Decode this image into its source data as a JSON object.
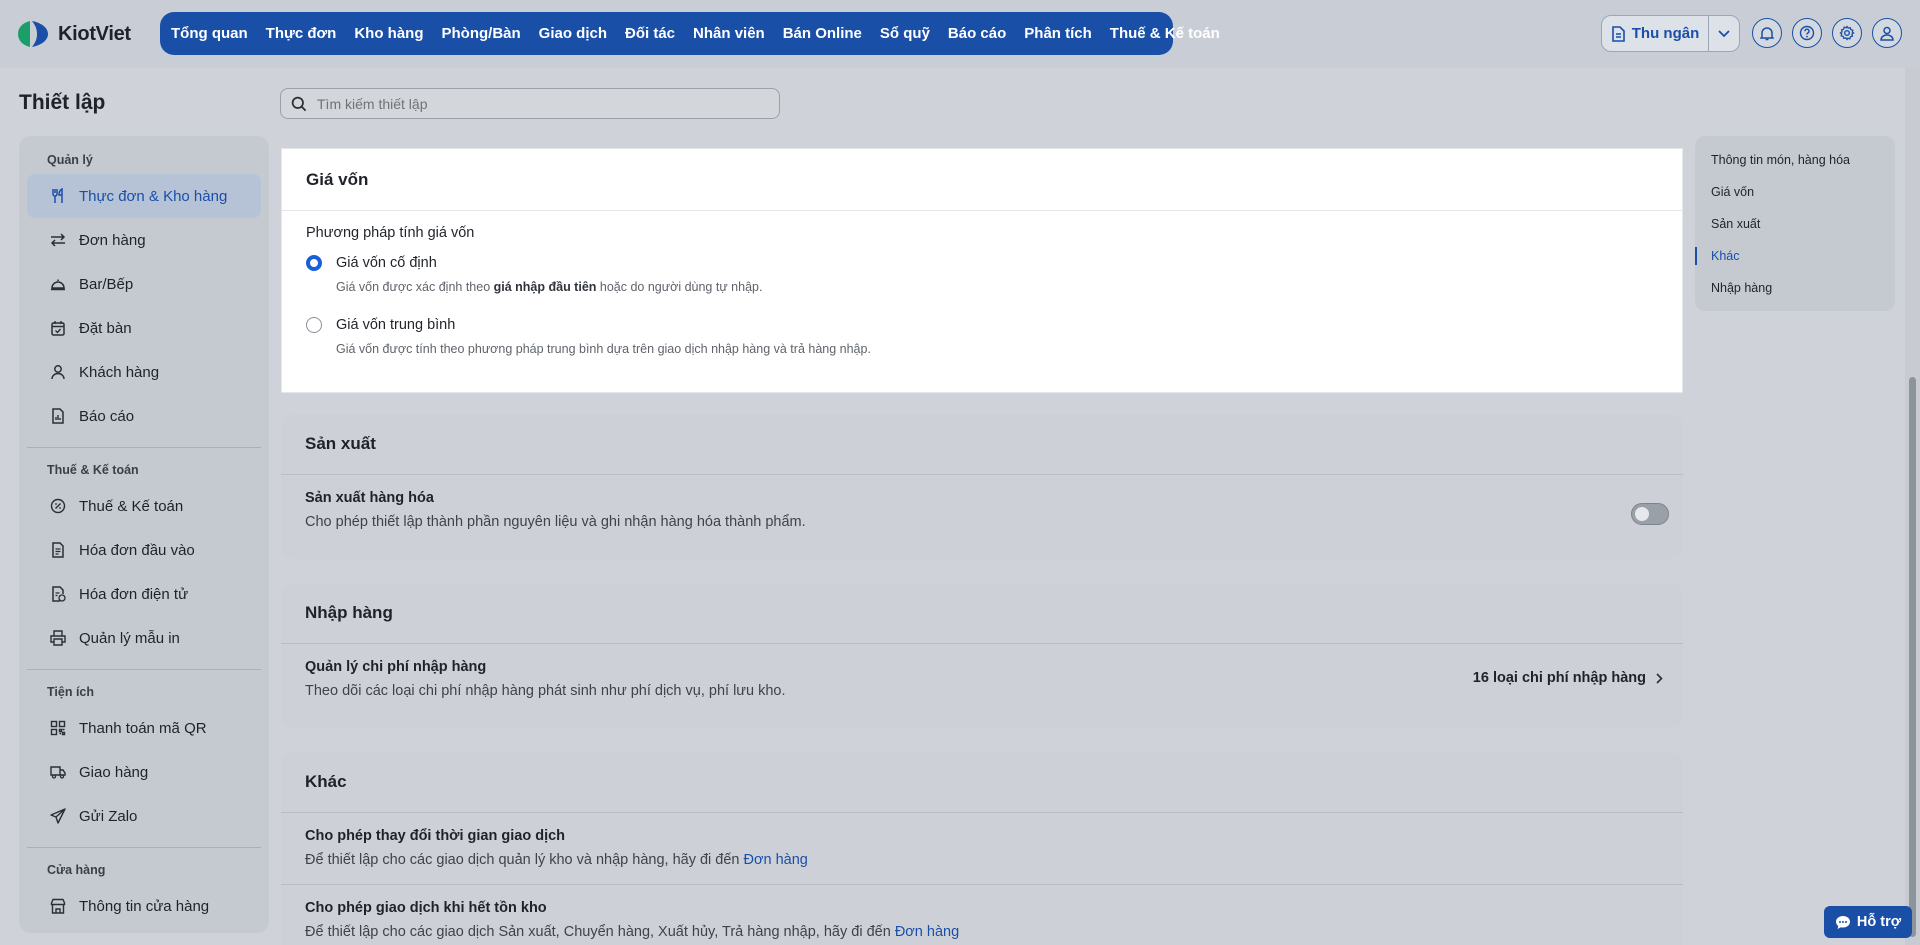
{
  "app": {
    "brand": "KiotViet",
    "accent": "#1a4fa8"
  },
  "nav": {
    "items": [
      "Tổng quan",
      "Thực đơn",
      "Kho hàng",
      "Phòng/Bàn",
      "Giao dịch",
      "Đối tác",
      "Nhân viên",
      "Bán Online",
      "Sổ quỹ",
      "Báo cáo",
      "Phân tích",
      "Thuế & Kế toán"
    ]
  },
  "header_actions": {
    "cashier_label": "Thu ngân",
    "icons": [
      "bell-icon",
      "help-icon",
      "settings-icon",
      "user-icon"
    ]
  },
  "page": {
    "title": "Thiết lập",
    "search_placeholder": "Tìm kiếm thiết lập"
  },
  "sidebar": {
    "groups": [
      {
        "label": "Quản lý",
        "items": [
          {
            "label": "Thực đơn & Kho hàng",
            "icon": "utensils-icon",
            "active": true
          },
          {
            "label": "Đơn hàng",
            "icon": "transfer-icon"
          },
          {
            "label": "Bar/Bếp",
            "icon": "cloche-icon"
          },
          {
            "label": "Đặt bàn",
            "icon": "calendar-check-icon"
          },
          {
            "label": "Khách hàng",
            "icon": "user-icon"
          },
          {
            "label": "Báo cáo",
            "icon": "report-icon"
          }
        ]
      },
      {
        "label": "Thuế & Kế toán",
        "items": [
          {
            "label": "Thuế & Kế toán",
            "icon": "percent-icon"
          },
          {
            "label": "Hóa đơn đầu vào",
            "icon": "document-icon"
          },
          {
            "label": "Hóa đơn điện tử",
            "icon": "e-invoice-icon"
          },
          {
            "label": "Quản lý mẫu in",
            "icon": "printer-icon"
          }
        ]
      },
      {
        "label": "Tiện ích",
        "items": [
          {
            "label": "Thanh toán mã QR",
            "icon": "qr-icon"
          },
          {
            "label": "Giao hàng",
            "icon": "truck-icon"
          },
          {
            "label": "Gửi Zalo",
            "icon": "send-icon"
          }
        ]
      },
      {
        "label": "Cửa hàng",
        "items": [
          {
            "label": "Thông tin cửa hàng",
            "icon": "store-icon"
          }
        ]
      }
    ]
  },
  "cost_price": {
    "title": "Giá vốn",
    "method_label": "Phương pháp tính giá vốn",
    "options": [
      {
        "label": "Giá vốn cố định",
        "desc_pre": "Giá vốn được xác định theo ",
        "desc_bold": "giá nhập đầu tiên",
        "desc_post": " hoặc do người dùng tự nhập.",
        "selected": true
      },
      {
        "label": "Giá vốn trung bình",
        "desc_pre": "Giá vốn được tính theo phương pháp trung bình dựa trên giao dịch nhập hàng và trả hàng nhập.",
        "desc_bold": "",
        "desc_post": "",
        "selected": false
      }
    ]
  },
  "production": {
    "title": "Sản xuất",
    "row_title": "Sản xuất hàng hóa",
    "row_desc": "Cho phép thiết lập thành phần nguyên liệu và ghi nhận hàng hóa thành phẩm.",
    "enabled": false
  },
  "purchasing": {
    "title": "Nhập hàng",
    "row_title": "Quản lý chi phí nhập hàng",
    "row_desc": "Theo dõi các loại chi phí nhập hàng phát sinh như phí dịch vụ, phí lưu kho.",
    "link_label": "16 loại chi phí nhập hàng"
  },
  "other": {
    "title": "Khác",
    "rows": [
      {
        "title": "Cho phép thay đổi thời gian giao dịch",
        "desc": "Để thiết lập cho các giao dịch quản lý kho và nhập hàng, hãy đi đến ",
        "link": "Đơn hàng"
      },
      {
        "title": "Cho phép giao dịch khi hết tồn kho",
        "desc": "Để thiết lập cho các giao dịch Sản xuất, Chuyển hàng, Xuất hủy, Trả hàng nhập, hãy đi đến ",
        "link": "Đơn hàng"
      }
    ]
  },
  "toc": {
    "items": [
      {
        "label": "Thông tin món, hàng hóa",
        "active": false
      },
      {
        "label": "Giá vốn",
        "active": false
      },
      {
        "label": "Sản xuất",
        "active": false
      },
      {
        "label": "Khác",
        "active": true
      },
      {
        "label": "Nhập hàng",
        "active": false
      }
    ]
  },
  "help": {
    "label": "Hỗ trợ"
  }
}
